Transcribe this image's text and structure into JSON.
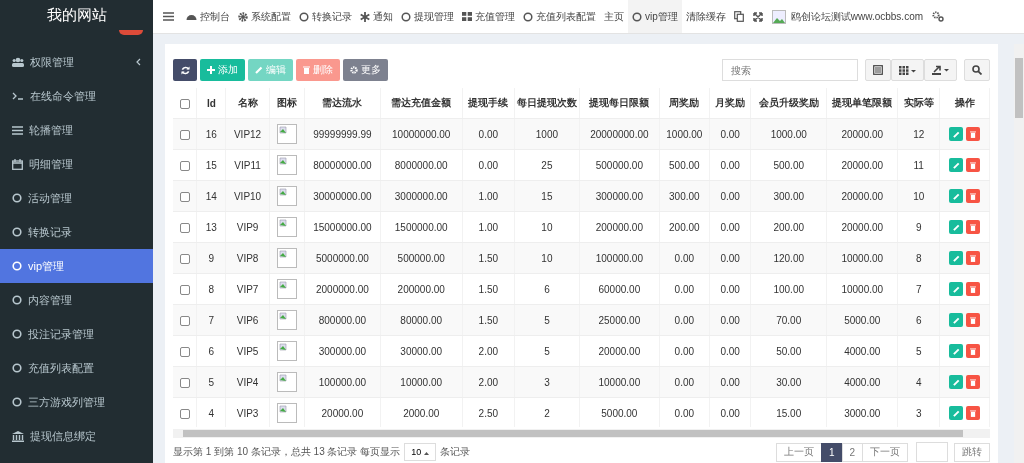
{
  "sidebar": {
    "logo": "我的网站",
    "items": [
      {
        "label": "权限管理",
        "selected": false,
        "expandable": true
      },
      {
        "label": "在线命令管理",
        "selected": false,
        "expandable": false
      },
      {
        "label": "轮播管理",
        "selected": false,
        "expandable": false
      },
      {
        "label": "明细管理",
        "selected": false,
        "expandable": false
      },
      {
        "label": "活动管理",
        "selected": false,
        "expandable": false
      },
      {
        "label": "转换记录",
        "selected": false,
        "expandable": false
      },
      {
        "label": "vip管理",
        "selected": true,
        "expandable": false
      },
      {
        "label": "内容管理",
        "selected": false,
        "expandable": false
      },
      {
        "label": "投注记录管理",
        "selected": false,
        "expandable": false
      },
      {
        "label": "充值列表配置",
        "selected": false,
        "expandable": false
      },
      {
        "label": "三方游戏列管理",
        "selected": false,
        "expandable": false
      },
      {
        "label": "提现信息绑定",
        "selected": false,
        "expandable": false
      }
    ]
  },
  "topbar": {
    "nav": [
      {
        "label": "控制台",
        "selected": false
      },
      {
        "label": "系统配置",
        "selected": false
      },
      {
        "label": "转换记录",
        "selected": false
      },
      {
        "label": "通知",
        "selected": false
      },
      {
        "label": "提现管理",
        "selected": false
      },
      {
        "label": "充值管理",
        "selected": false
      },
      {
        "label": "充值列表配置",
        "selected": false
      },
      {
        "label": "主页",
        "selected": false
      },
      {
        "label": "vip管理",
        "selected": true
      },
      {
        "label": "清除缓存",
        "selected": false
      }
    ],
    "user": "鸥创论坛测试www.ocbbs.com"
  },
  "toolbar": {
    "buttons": [
      {
        "kind": "refresh"
      },
      {
        "kind": "add",
        "label": "添加",
        "disabled": false
      },
      {
        "kind": "edit",
        "label": "编辑",
        "disabled": true
      },
      {
        "kind": "delete",
        "label": "删除",
        "disabled": true
      },
      {
        "kind": "more",
        "label": "更多",
        "disabled": false
      }
    ],
    "search": {
      "placeholder": "搜索"
    }
  },
  "table": {
    "all_checked": false,
    "columns": [
      "Id",
      "名称",
      "图标",
      "需达流水",
      "需达充值金额",
      "提现手续",
      "每日提现次数",
      "提现每日限额",
      "周奖励",
      "月奖励",
      "会员升级奖励",
      "提现单笔限额",
      "实际等",
      "操作"
    ],
    "rows": [
      {
        "checked": false,
        "cells": [
          "16",
          "VIP12",
          "",
          "99999999.99",
          "10000000.00",
          "0.00",
          "1000",
          "20000000.00",
          "1000.00",
          "0.00",
          "1000.00",
          "20000.00",
          "12"
        ]
      },
      {
        "checked": false,
        "cells": [
          "15",
          "VIP11",
          "",
          "80000000.00",
          "8000000.00",
          "0.00",
          "25",
          "500000.00",
          "500.00",
          "0.00",
          "500.00",
          "20000.00",
          "11"
        ]
      },
      {
        "checked": false,
        "cells": [
          "14",
          "VIP10",
          "",
          "30000000.00",
          "3000000.00",
          "1.00",
          "15",
          "300000.00",
          "300.00",
          "0.00",
          "300.00",
          "20000.00",
          "10"
        ]
      },
      {
        "checked": false,
        "cells": [
          "13",
          "VIP9",
          "",
          "15000000.00",
          "1500000.00",
          "1.00",
          "10",
          "200000.00",
          "200.00",
          "0.00",
          "200.00",
          "20000.00",
          "9"
        ]
      },
      {
        "checked": false,
        "cells": [
          "9",
          "VIP8",
          "",
          "5000000.00",
          "500000.00",
          "1.50",
          "10",
          "100000.00",
          "0.00",
          "0.00",
          "120.00",
          "10000.00",
          "8"
        ]
      },
      {
        "checked": false,
        "cells": [
          "8",
          "VIP7",
          "",
          "2000000.00",
          "200000.00",
          "1.50",
          "6",
          "60000.00",
          "0.00",
          "0.00",
          "100.00",
          "10000.00",
          "7"
        ]
      },
      {
        "checked": false,
        "cells": [
          "7",
          "VIP6",
          "",
          "800000.00",
          "80000.00",
          "1.50",
          "5",
          "25000.00",
          "0.00",
          "0.00",
          "70.00",
          "5000.00",
          "6"
        ]
      },
      {
        "checked": false,
        "cells": [
          "6",
          "VIP5",
          "",
          "300000.00",
          "30000.00",
          "2.00",
          "5",
          "20000.00",
          "0.00",
          "0.00",
          "50.00",
          "4000.00",
          "5"
        ]
      },
      {
        "checked": false,
        "cells": [
          "5",
          "VIP4",
          "",
          "100000.00",
          "10000.00",
          "2.00",
          "3",
          "10000.00",
          "0.00",
          "0.00",
          "30.00",
          "4000.00",
          "4"
        ]
      },
      {
        "checked": false,
        "cells": [
          "4",
          "VIP3",
          "",
          "20000.00",
          "2000.00",
          "2.50",
          "2",
          "5000.00",
          "0.00",
          "0.00",
          "15.00",
          "3000.00",
          "3"
        ]
      }
    ]
  },
  "footer": {
    "summary": "显示第 1 到第 10 条记录，总共 13 条记录 每页显示",
    "page_size": "10",
    "summary_end": "条记录",
    "pages": [
      {
        "label": "上一页",
        "selected": false
      },
      {
        "label": "1",
        "selected": true
      },
      {
        "label": "2",
        "selected": false
      },
      {
        "label": "下一页",
        "selected": false
      }
    ],
    "jump": "跳转"
  }
}
